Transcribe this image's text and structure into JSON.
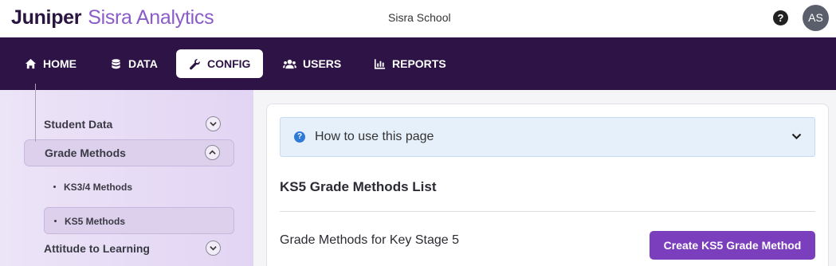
{
  "header": {
    "brand_strong": "Juniper",
    "brand_light": "Sisra Analytics",
    "school_name": "Sisra School",
    "help_icon": "question-circle-icon",
    "avatar_initials": "AS"
  },
  "nav": {
    "items": [
      {
        "label": "HOME",
        "icon": "home-icon",
        "active": false
      },
      {
        "label": "DATA",
        "icon": "database-icon",
        "active": false
      },
      {
        "label": "CONFIG",
        "icon": "wrench-icon",
        "active": true
      },
      {
        "label": "USERS",
        "icon": "users-icon",
        "active": false
      },
      {
        "label": "REPORTS",
        "icon": "bar-chart-icon",
        "active": false
      }
    ]
  },
  "sidebar": {
    "items": [
      {
        "label": "Student Data",
        "expanded": false
      },
      {
        "label": "Grade Methods",
        "expanded": true,
        "children": [
          {
            "label": "KS3/4 Methods",
            "active": false
          },
          {
            "label": "KS5 Methods",
            "active": true
          }
        ]
      },
      {
        "label": "Attitude to Learning",
        "expanded": false
      }
    ]
  },
  "main": {
    "howto_label": "How to use this page",
    "section_title": "KS5 Grade Methods List",
    "subsection_title": "Grade Methods for Key Stage 5",
    "create_button_label": "Create KS5 Grade Method"
  },
  "colors": {
    "nav_bg": "#2e1446",
    "brand_accent": "#8b5cc9",
    "button_primary": "#7b3fbd",
    "info_bg": "#e6f0fb"
  }
}
